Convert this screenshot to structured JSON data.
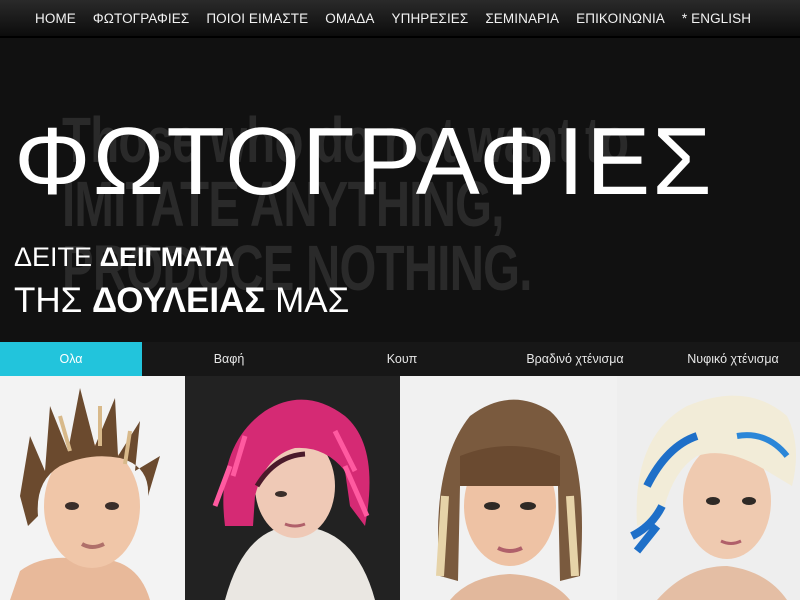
{
  "nav": {
    "items": [
      {
        "label": "HOME"
      },
      {
        "label": "ΦΩΤΟΓΡΑΦΙΕΣ"
      },
      {
        "label": "ΠΟΙΟΙ ΕΙΜΑΣΤΕ"
      },
      {
        "label": "ΟΜΑΔΑ"
      },
      {
        "label": "ΥΠΗΡΕΣΙΕΣ"
      },
      {
        "label": "ΣΕΜΙΝΑΡΙΑ"
      },
      {
        "label": "ΕΠΙΚΟΙΝΩΝΙΑ"
      },
      {
        "label": "* ENGLISH"
      }
    ]
  },
  "hero": {
    "title": "ΦΩΤΟΓΡΑΦΙΕΣ",
    "line1_light": "ΔΕΙΤΕ ",
    "line1_bold": "ΔΕΙΓΜΑΤΑ",
    "line2_light": "ΤΗΣ ",
    "line2_bold": "ΔΟΥΛΕΙΑΣ",
    "line2_end": " ΜΑΣ",
    "background_quote": "Those who do not want to\nIMITATE ANYTHING,\nPRODUCE NOTHING."
  },
  "filters": {
    "items": [
      {
        "label": "Ολα",
        "active": true
      },
      {
        "label": "Βαφή",
        "active": false
      },
      {
        "label": "Κουπ",
        "active": false
      },
      {
        "label": "Βραδινό χτένισμα",
        "active": false
      },
      {
        "label": "Νυφικό χτένισμα",
        "active": false
      }
    ]
  },
  "gallery": {
    "photos": [
      {
        "subject": "short-spiky-blonde-highlights"
      },
      {
        "subject": "pink-layered-bob"
      },
      {
        "subject": "blonde-brown-bob-with-bangs"
      },
      {
        "subject": "platinum-blue-asymmetric-cut"
      }
    ]
  },
  "colors": {
    "accent": "#22c4dc",
    "nav_bg": "#1a1a1a",
    "hero_bg": "#111111",
    "text": "#ffffff"
  }
}
